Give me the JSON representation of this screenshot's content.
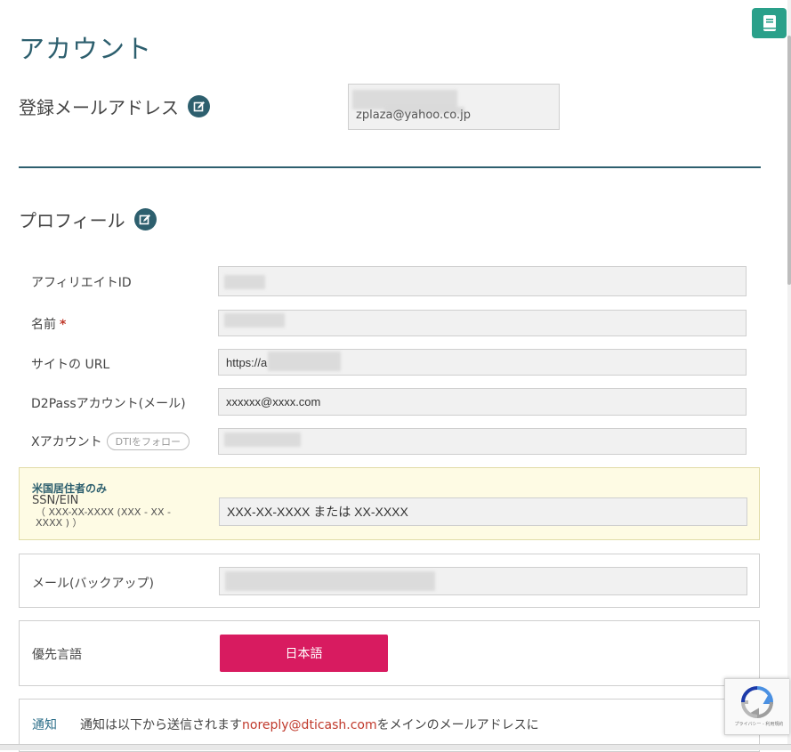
{
  "page": {
    "title": "アカウント"
  },
  "registered_email": {
    "heading": "登録メールアドレス",
    "value": "zplaza@yahoo.co.jp"
  },
  "profile": {
    "heading": "プロフィール",
    "fields": {
      "affiliate_id": {
        "label": "アフィリエイトID",
        "value": ""
      },
      "name": {
        "label": "名前",
        "required_mark": "*",
        "value": ""
      },
      "site_url": {
        "label": "サイトの URL",
        "value": "https://a"
      },
      "d2pass": {
        "label": "D2Passアカウント(メール)",
        "value": "xxxxxx@xxxx.com"
      },
      "x_account": {
        "label": "Xアカウント",
        "follow_label": "DTIをフォロー",
        "value": ""
      }
    }
  },
  "us_residents": {
    "title": "米国居住者のみ",
    "label": "SSN/EIN",
    "hint": "（ XXX-XX-XXXX (XXX - XX - XXXX ) ）",
    "placeholder": "XXX-XX-XXXX または XX-XXXX"
  },
  "backup_email": {
    "label": "メール(バックアップ)",
    "value": ""
  },
  "language": {
    "label": "優先言語",
    "button_label": "日本語"
  },
  "notification": {
    "label": "通知",
    "text_before": "通知は以下から送信されます",
    "sender": "noreply@dticash.com",
    "text_after": "をメインのメールアドレスに"
  },
  "recaptcha": {
    "footer": "プライバシー - 利用規約"
  },
  "colors": {
    "accent": "#2d5f6e",
    "primary_button": "#d81b60",
    "book_button": "#2aa08a",
    "notice_bg": "#fefbe4"
  },
  "icons": {
    "book": "book-icon",
    "edit": "edit-icon",
    "recaptcha": "recaptcha-icon"
  }
}
